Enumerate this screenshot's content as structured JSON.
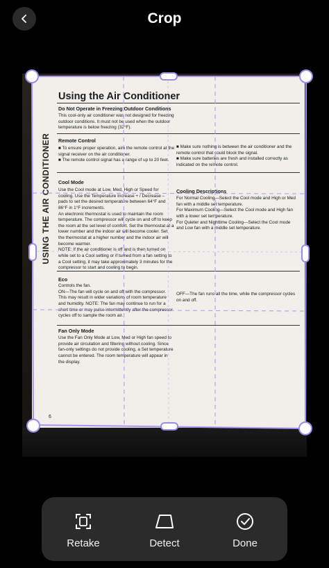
{
  "header": {
    "title": "Crop"
  },
  "document": {
    "side_title": "USING THE AIR CONDITIONER",
    "title": "Using the Air Conditioner",
    "sections": [
      {
        "heading": "Do Not Operate in Freezing Outdoor Conditions",
        "left": "This cool-only air conditioner was not designed for freezing outdoor conditions. It must not be used when the outdoor temperature is below freezing (32°F)."
      },
      {
        "heading": "Remote Control",
        "left": "■ To ensure proper operation, aim the remote control at the signal receiver on the air conditioner.\n■ The remote control signal has a range of up to 20 feet.",
        "right": "■ Make sure nothing is between the air conditioner and the remote control that could block the signal.\n■ Make sure batteries are fresh and installed correctly as indicated on the remote control."
      },
      {
        "heading": "Cool Mode",
        "left": "Use the Cool mode at Low, Med, High or Speed for cooling. Use the Temperature Increase + / Decrease – pads to set the desired temperature between 64°F and 86°F in 1°F increments.\nAn electronic thermostat is used to maintain the room temperature. The compressor will cycle on and off to keep the room at the set level of comfort. Set the thermostat at a lower number and the indoor air will become cooler. Set the thermostat at a higher number and the indoor air will become warmer.\nNOTE: If the air conditioner is off and is then turned on while set to a Cool setting or if turned from a fan setting to a Cool setting, it may take approximately 3 minutes for the compressor to start and cooling to begin.",
        "right_heading": "Cooling Descriptions",
        "right": "For Normal Cooling—Select the Cool mode and High or Med fan with a middle set temperature.\nFor Maximum Cooling—Select the Cool mode and High fan with a lower set temperature.\nFor Quieter and Nighttime Cooling—Select the Cool mode and Low fan with a middle set temperature."
      },
      {
        "heading": "Eco",
        "left": "Controls the fan.\nON—The fan will cycle on and off with the compressor. This may result in wider variations of room temperature and humidity. NOTE: The fan may continue to run for a short time or may pulse intermittently after the compressor cycles off to sample the room air.",
        "right": "OFF—The fan runs all the time, while the compressor cycles on and off."
      },
      {
        "heading": "Fan Only Mode",
        "left": "Use the Fan Only Mode at Low, Med or High fan speed to provide air circulation and filtering without cooling. Since fan-only settings do not provide cooling, a Set temperature cannot be entered. The room temperature will appear in the display."
      }
    ],
    "page_number": "6"
  },
  "toolbar": {
    "retake_label": "Retake",
    "detect_label": "Detect",
    "done_label": "Done"
  },
  "colors": {
    "accent": "#9b8be6",
    "toolbar_bg": "#2b2b2b"
  },
  "icons": {
    "back": "chevron-left-icon",
    "retake": "retake-icon",
    "detect": "detect-icon",
    "done": "done-check-icon"
  }
}
